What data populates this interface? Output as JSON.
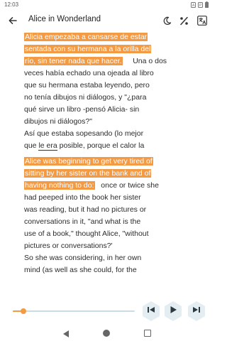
{
  "status": {
    "time": "12:03",
    "icons": [
      "a-status-icon",
      "p-status-icon",
      "battery-icon"
    ]
  },
  "app_bar": {
    "title": "Alice in Wonderland",
    "icons": [
      "back-arrow-icon",
      "moon-icon",
      "percent-icon",
      "translate-icon"
    ]
  },
  "content": {
    "spanish": {
      "highlighted_lines": [
        "Alicia empezaba a cansarse de estar",
        "sentada con su hermana a la orilla del",
        "río, sin tener nada que hacer."
      ],
      "trailing_first": "Una o dos",
      "lines": [
        "veces había echado una ojeada al libro",
        "que su hermana estaba leyendo, pero",
        "no tenía dibujos ni diálogos, y \"¿para",
        "qué sirve un libro -pensó Alicia- sin",
        "dibujos ni diálogos?\"",
        "Así que estaba sopesando (lo mejor"
      ],
      "last_line": {
        "before": "que ",
        "underlined": "le era",
        "after": " posible, porque el calor la"
      }
    },
    "english": {
      "highlighted_lines": [
        "Alice was beginning to get very tired of",
        "sitting by her sister on the bank and of",
        "having nothing to do:"
      ],
      "trailing_first": "once or twice she",
      "lines": [
        "had peeped into the book her sister",
        "was reading, but it had no pictures or",
        "conversations in it, \"and what is the",
        "use of a book,\" thought Alice, \"without",
        "pictures or conversations?'",
        "So she was considering, in her own",
        "mind (as well as she could, for the"
      ]
    }
  },
  "player": {
    "progress": 0.09,
    "accent_color": "#f39a45",
    "track_color": "#c9dde6",
    "hex_color": "#e4edf1"
  },
  "nav": {
    "icons": [
      "nav-back-icon",
      "nav-home-icon",
      "nav-recent-icon"
    ]
  }
}
